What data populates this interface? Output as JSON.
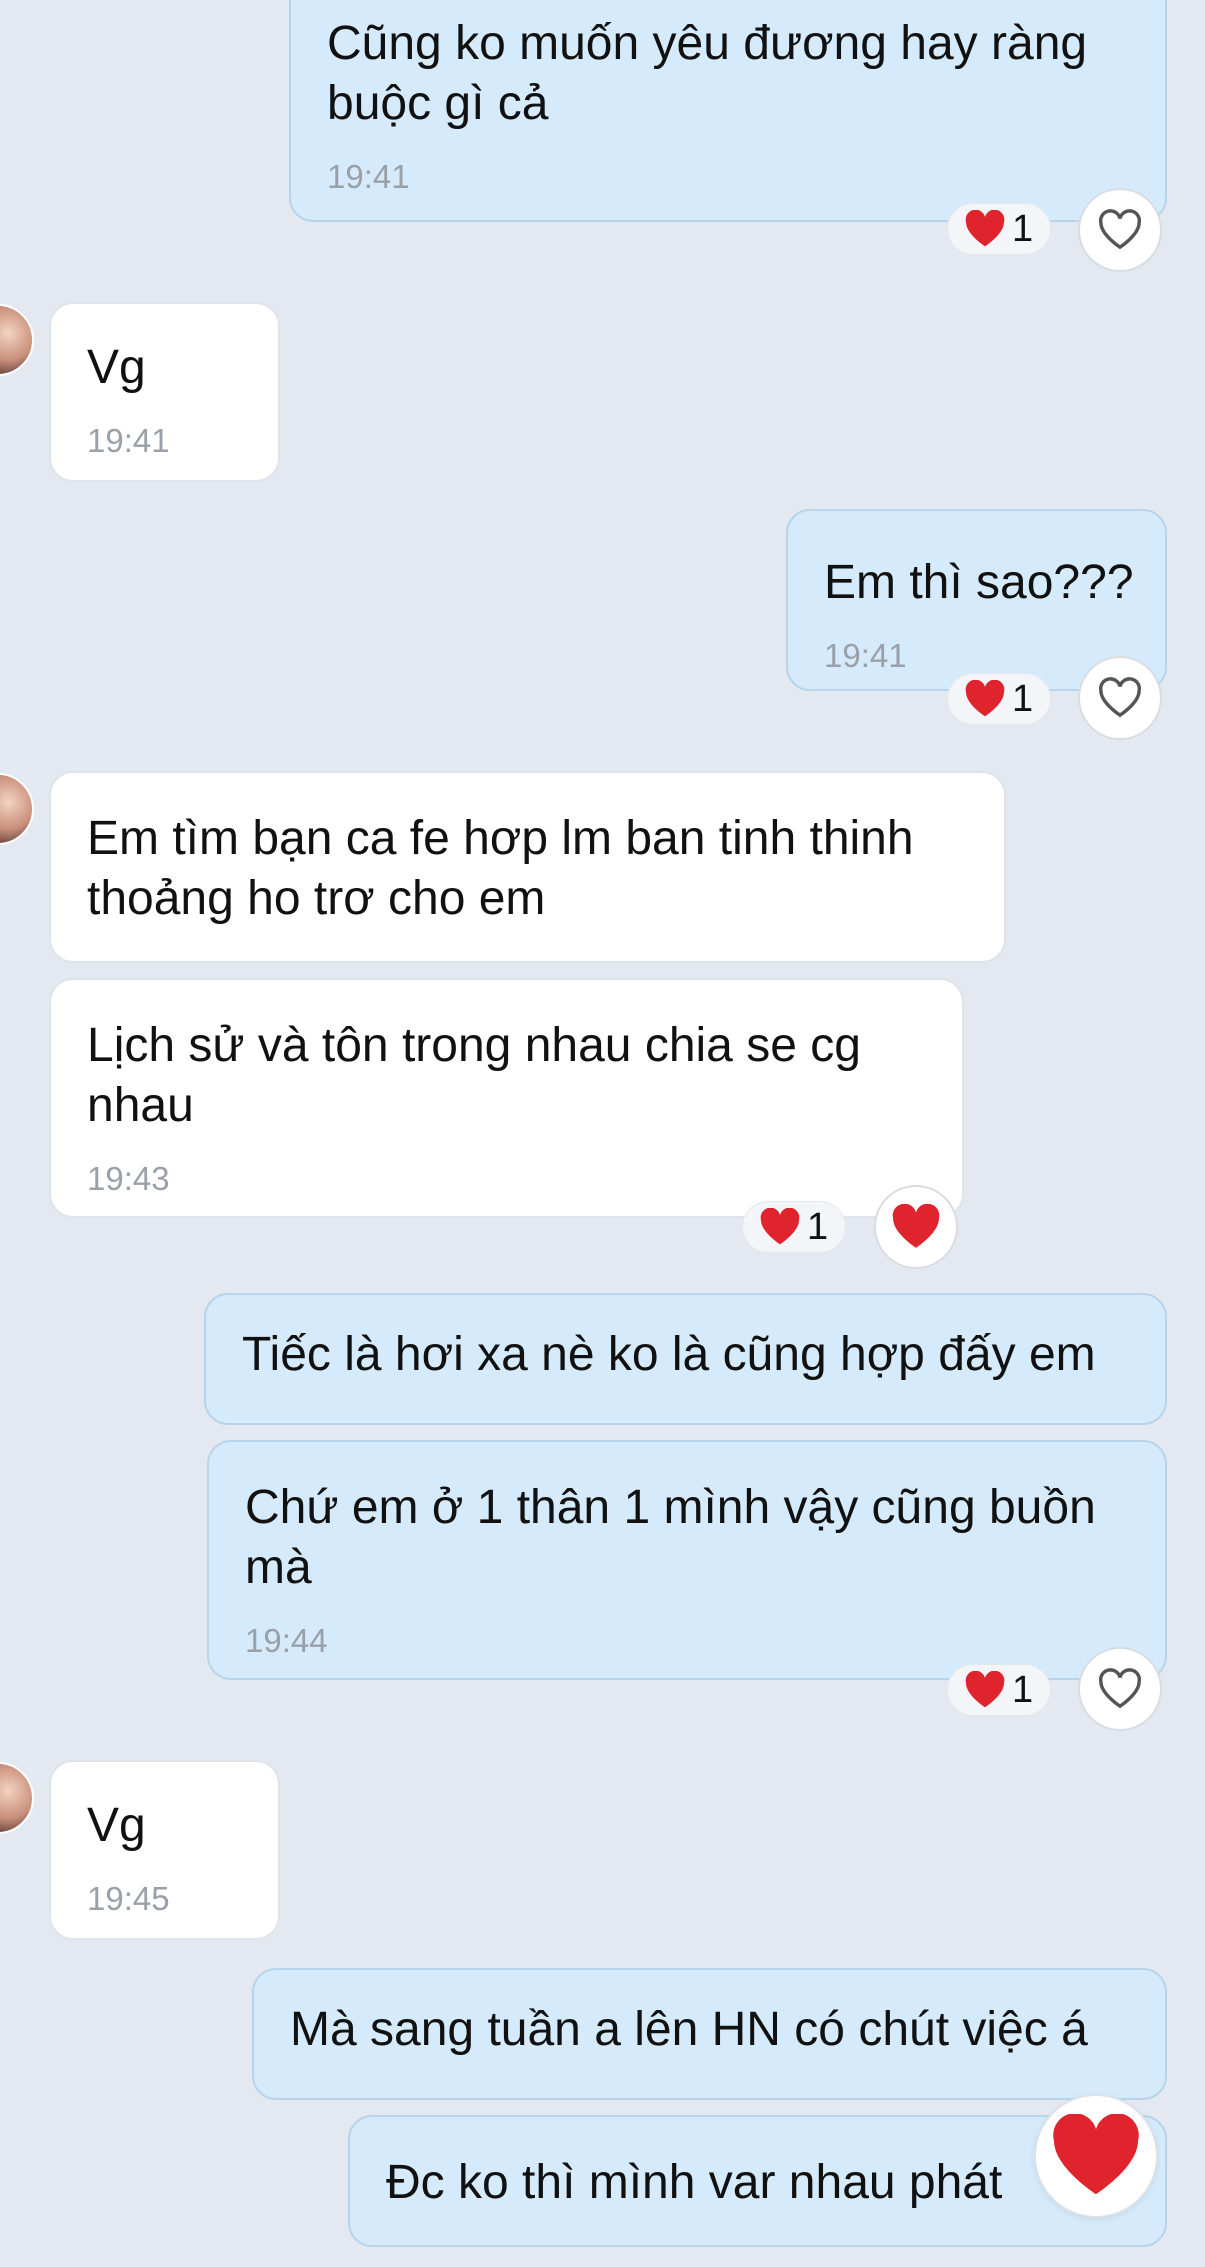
{
  "messages": {
    "m1": {
      "text": "Cũng ko muốn yêu đương hay ràng\nbuộc gì cả",
      "time": "19:41",
      "reaction_count": "1"
    },
    "m2": {
      "text": "Vg",
      "time": "19:41"
    },
    "m3": {
      "text": "Em thì sao???",
      "time": "19:41",
      "reaction_count": "1"
    },
    "m4": {
      "text": "Em tìm bạn ca fe hơp lm ban tinh thinh\nthoảng ho trơ cho em"
    },
    "m5": {
      "text": "Lịch sử  và tôn trong nhau chia se cg\nnhau",
      "time": "19:43",
      "reaction_count": "1"
    },
    "m6": {
      "text": "Tiếc là hơi xa nè ko là cũng hợp đấy em"
    },
    "m7": {
      "text": "Chứ em ở 1 thân 1 mình vậy cũng buồn\nmà",
      "time": "19:44",
      "reaction_count": "1"
    },
    "m8": {
      "text": "Vg",
      "time": "19:45"
    },
    "m9": {
      "text": "Mà sang tuần a lên HN có chút việc á"
    },
    "m10": {
      "text": "Đc ko thì mình var nhau phát"
    }
  },
  "icons": {
    "reaction": "red-heart-icon",
    "like_empty": "heart-outline-icon",
    "like_filled": "red-heart-icon"
  },
  "colors": {
    "outgoing_bubble": "#d5ebfb",
    "incoming_bubble": "#ffffff",
    "background": "#e4e8f1",
    "heart": "#e0242e"
  }
}
